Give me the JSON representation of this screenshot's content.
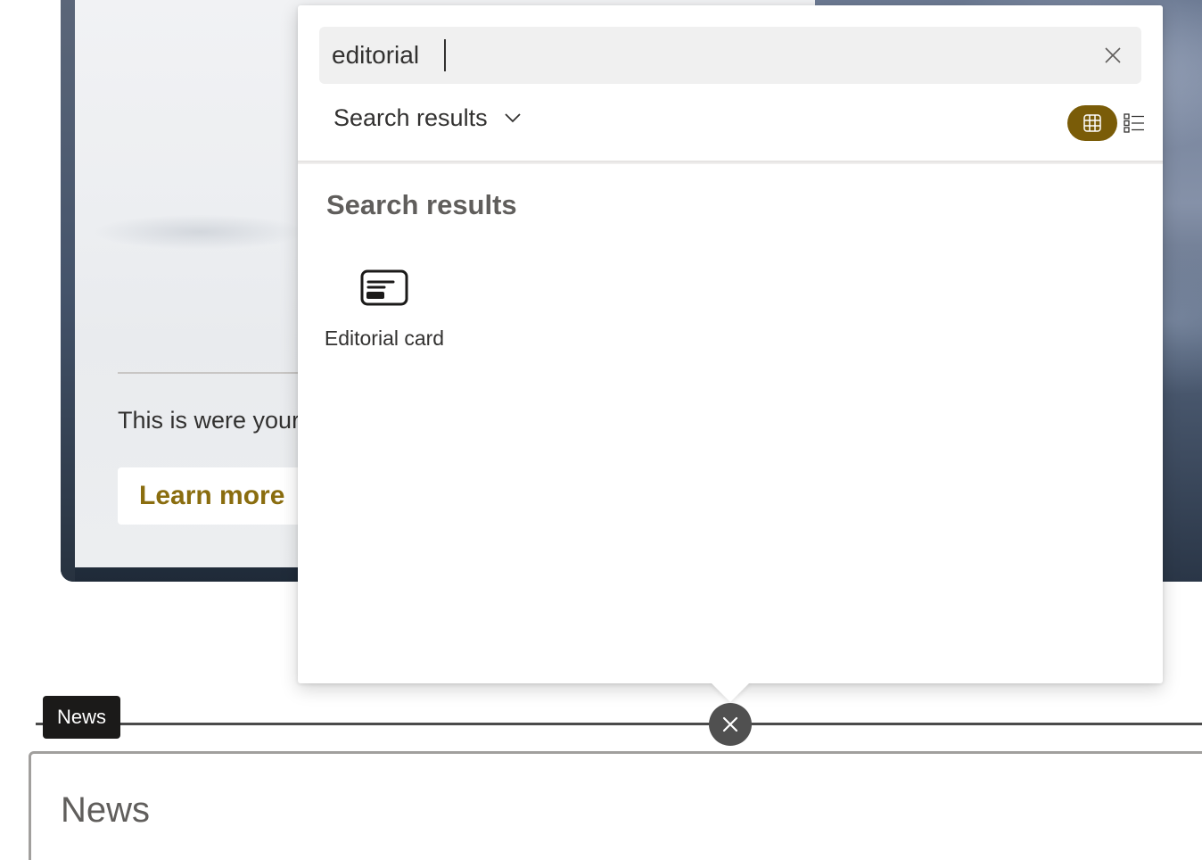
{
  "hero": {
    "body_text": "This is were your",
    "cta_label": "Learn more"
  },
  "toolbox": {
    "search": {
      "value": "editorial",
      "clear_icon": "close-icon"
    },
    "category_label": "Search results",
    "category_icon": "chevron-down-icon",
    "view_toggle": {
      "grid_icon": "grid-view-icon",
      "list_icon": "list-view-icon",
      "active": "grid"
    },
    "results_heading": "Search results",
    "results": [
      {
        "label": "Editorial card",
        "icon": "editorial-card-icon"
      }
    ],
    "close_icon": "close-icon"
  },
  "section": {
    "tag": "News",
    "title": "News"
  },
  "colors": {
    "accent": "#7a5c08",
    "link": "#8a6d0f",
    "tag_bg": "#1b1a19"
  }
}
